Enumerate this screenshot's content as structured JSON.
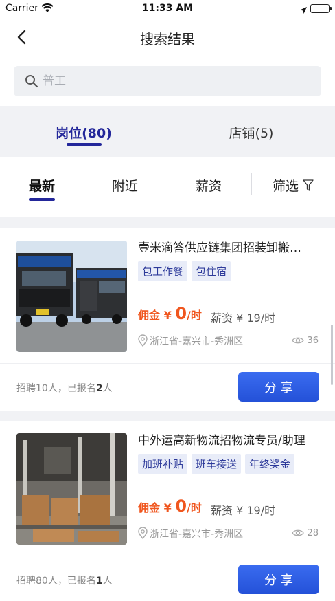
{
  "status_bar": {
    "carrier": "Carrier",
    "time": "11:33 AM"
  },
  "nav": {
    "title": "搜索结果"
  },
  "search": {
    "placeholder": "普工"
  },
  "tabs": [
    {
      "label": "岗位(80)",
      "active": true
    },
    {
      "label": "店铺(5)",
      "active": false
    }
  ],
  "filters": [
    {
      "label": "最新",
      "active": true
    },
    {
      "label": "附近"
    },
    {
      "label": "薪资"
    },
    {
      "label": "筛选"
    }
  ],
  "jobs": [
    {
      "title": "壹米滴答供应链集团招装卸搬…",
      "tags": [
        "包工作餐",
        "包住宿"
      ],
      "commission_label": "佣金",
      "commission_currency": "¥",
      "commission_amount": "0",
      "commission_unit": "/时",
      "salary": "薪资 ¥ 19/时",
      "location": "浙江省-嘉兴市-秀洲区",
      "views": "36",
      "recruit_prefix": "招聘10人，已报名",
      "recruit_count": "2",
      "recruit_suffix": "人",
      "share_label": "分享",
      "photo": "trucks-photo"
    },
    {
      "title": "中外运高新物流招物流专员/助理",
      "tags": [
        "加班补贴",
        "班车接送",
        "年终奖金"
      ],
      "commission_label": "佣金",
      "commission_currency": "¥",
      "commission_amount": "0",
      "commission_unit": "/时",
      "salary": "薪资 ¥ 19/时",
      "location": "浙江省-嘉兴市-秀洲区",
      "views": "28",
      "recruit_prefix": "招聘80人，已报名",
      "recruit_count": "1",
      "recruit_suffix": "人",
      "share_label": "分享",
      "photo": "warehouse-photo"
    }
  ],
  "colors": {
    "accent": "#23279a",
    "commission": "#f0561e",
    "share_button": "#2d5ee6"
  }
}
